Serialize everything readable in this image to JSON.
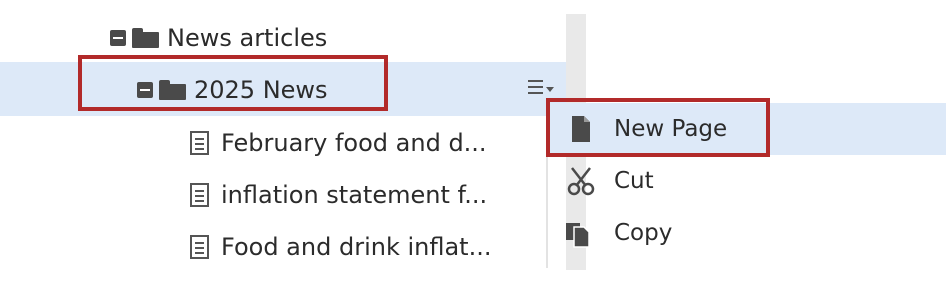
{
  "tree": {
    "root": {
      "label": "News articles"
    },
    "selected": {
      "label": "2025 News"
    },
    "children": [
      {
        "label": "February food and d..."
      },
      {
        "label": "inflation statement f..."
      },
      {
        "label": "Food and drink inflat..."
      }
    ]
  },
  "context_menu": {
    "items": [
      {
        "label": "New Page",
        "icon": "new-page-icon"
      },
      {
        "label": "Cut",
        "icon": "scissors-icon"
      },
      {
        "label": "Copy",
        "icon": "copy-icon"
      }
    ]
  },
  "colors": {
    "selection": "#dde9f8",
    "highlight_box": "#b22a2a",
    "icon": "#4a4a4a"
  }
}
